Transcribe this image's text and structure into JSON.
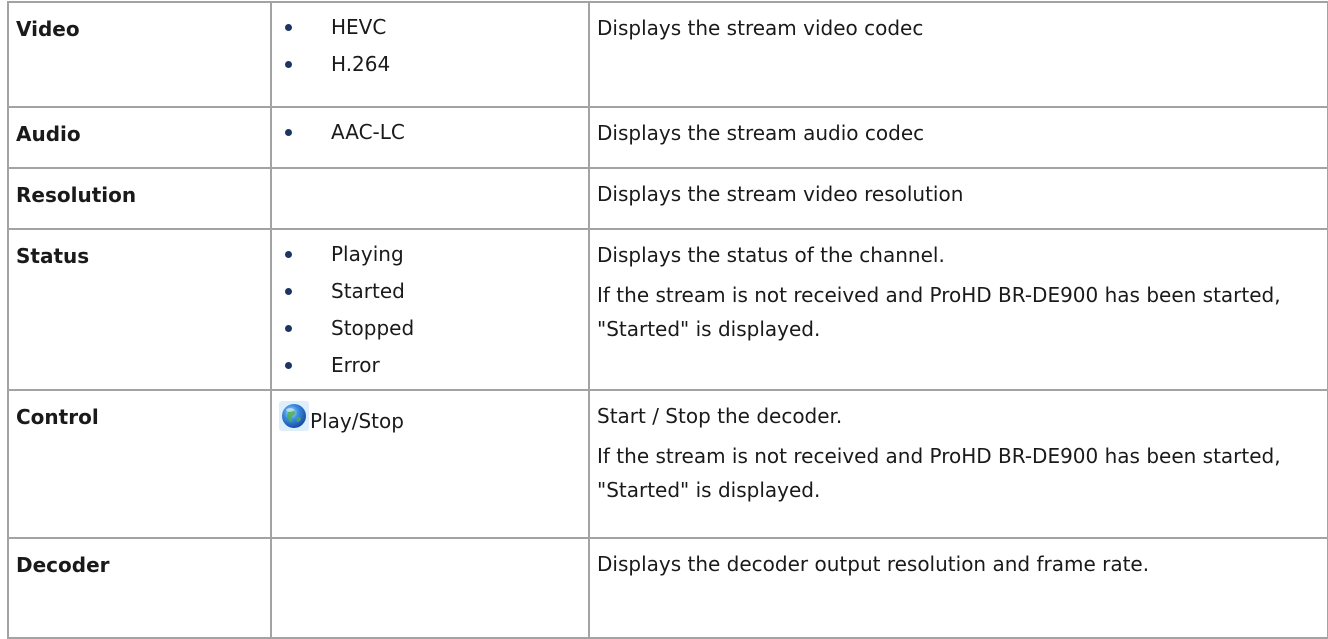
{
  "rows": [
    {
      "label": "Video",
      "values": [
        "HEVC",
        "H.264"
      ],
      "description": [
        "Displays the stream video codec"
      ]
    },
    {
      "label": "Audio",
      "values": [
        "AAC-LC"
      ],
      "description": [
        "Displays the stream audio codec"
      ]
    },
    {
      "label": "Resolution",
      "values": [],
      "description": [
        "Displays the stream video resolution"
      ]
    },
    {
      "label": "Status",
      "values": [
        "Playing",
        "Started",
        "Stopped",
        "Error"
      ],
      "description": [
        "Displays the status of the channel.",
        "If the stream is not received and ProHD BR-DE900 has been started, \"Started\" is displayed."
      ]
    },
    {
      "label": "Control",
      "control": {
        "icon": "globe-icon",
        "label": "Play/Stop"
      },
      "description": [
        "Start / Stop the decoder.",
        "If the stream is not received and ProHD BR-DE900 has been started, \"Started\" is displayed."
      ]
    },
    {
      "label": "Decoder",
      "values": [],
      "description": [
        "Displays the decoder output resolution and frame rate."
      ]
    }
  ],
  "colors": {
    "border": "#a3a3a3",
    "text": "#1a1a1a",
    "bullet": "#1c3561"
  }
}
